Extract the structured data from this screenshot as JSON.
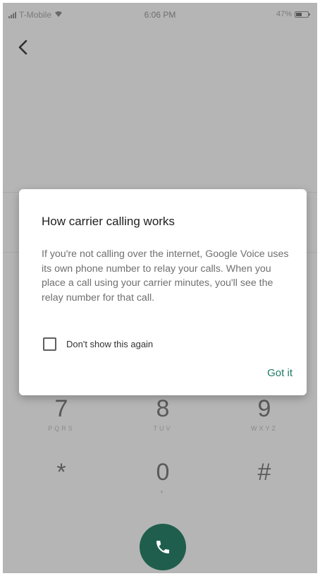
{
  "status_bar": {
    "carrier": "T-Mobile",
    "time": "6:06 PM",
    "battery_percent": "47%",
    "icons": [
      "signal-icon",
      "wifi-icon",
      "battery-icon"
    ]
  },
  "nav": {
    "back_icon": "chevron-left-icon"
  },
  "dialog": {
    "title": "How carrier calling works",
    "body": "If you're not calling over the internet, Google Voice uses its own phone number to relay your calls. When you place a call using your carrier minutes, you'll see the relay number for that call.",
    "checkbox_label": "Don't show this again",
    "checkbox_checked": false,
    "confirm_label": "Got it"
  },
  "dialpad": {
    "keys": [
      {
        "digit": "7",
        "letters": "PQRS"
      },
      {
        "digit": "8",
        "letters": "TUV"
      },
      {
        "digit": "9",
        "letters": "WXYZ"
      },
      {
        "digit": "*",
        "letters": ""
      },
      {
        "digit": "0",
        "letters": "+"
      },
      {
        "digit": "#",
        "letters": ""
      }
    ]
  },
  "call_button": {
    "icon": "phone-icon"
  },
  "colors": {
    "scrim": "#b5b5b5",
    "accent": "#1e7a63",
    "call_button": "#1f5e4c",
    "dialog_bg": "#ffffff"
  }
}
